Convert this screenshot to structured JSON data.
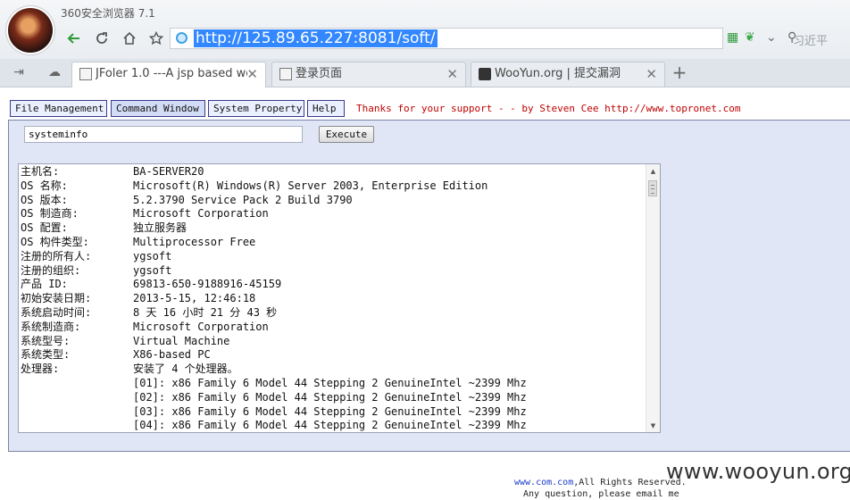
{
  "browser": {
    "title": "360安全浏览器 7.1",
    "url": "http://125.89.65.227:8081/soft/",
    "search_hint": "习近平",
    "icons": {
      "back": "back-arrow-icon",
      "reload": "reload-icon",
      "home": "home-icon",
      "favorite": "star-icon",
      "new_tab": "plus-icon"
    }
  },
  "tabs": [
    {
      "label": "JFoler 1.0 ---A jsp based web",
      "active": true
    },
    {
      "label": "登录页面",
      "active": false
    },
    {
      "label": "WooYun.org | 提交漏洞",
      "active": false
    }
  ],
  "menu": {
    "items": [
      "File Management",
      "Command Window",
      "System Property",
      "Help"
    ],
    "active": "Command Window",
    "thanks": "Thanks for your support - - by Steven Cee http://www.topronet.com"
  },
  "command": {
    "value": "systeminfo",
    "execute_label": "Execute"
  },
  "output": [
    {
      "key": "主机名:",
      "value": "BA-SERVER20"
    },
    {
      "key": "OS 名称:",
      "value": "Microsoft(R) Windows(R) Server 2003, Enterprise Edition"
    },
    {
      "key": "OS 版本:",
      "value": "5.2.3790 Service Pack 2 Build 3790"
    },
    {
      "key": "OS 制造商:",
      "value": "Microsoft Corporation"
    },
    {
      "key": "OS 配置:",
      "value": "独立服务器"
    },
    {
      "key": "OS 构件类型:",
      "value": "Multiprocessor Free"
    },
    {
      "key": "注册的所有人:",
      "value": "ygsoft"
    },
    {
      "key": "注册的组织:",
      "value": "ygsoft"
    },
    {
      "key": "产品 ID:",
      "value": "69813-650-9188916-45159"
    },
    {
      "key": "初始安装日期:",
      "value": "2013-5-15, 12:46:18"
    },
    {
      "key": "系统启动时间:",
      "value": "8 天 16 小时 21 分 43 秒"
    },
    {
      "key": "系统制造商:",
      "value": "Microsoft Corporation"
    },
    {
      "key": "系统型号:",
      "value": "Virtual Machine"
    },
    {
      "key": "系统类型:",
      "value": "X86-based PC"
    },
    {
      "key": "处理器:",
      "value": "安装了 4 个处理器。"
    },
    {
      "key": "",
      "value": "[01]: x86 Family 6 Model 44 Stepping 2 GenuineIntel ~2399 Mhz"
    },
    {
      "key": "",
      "value": "[02]: x86 Family 6 Model 44 Stepping 2 GenuineIntel ~2399 Mhz"
    },
    {
      "key": "",
      "value": "[03]: x86 Family 6 Model 44 Stepping 2 GenuineIntel ~2399 Mhz"
    },
    {
      "key": "",
      "value": "[04]: x86 Family 6 Model 44 Stepping 2 GenuineIntel ~2399 Mhz"
    }
  ],
  "footer": {
    "link": "www.com.com",
    "rights": ",All Rights Reserved.",
    "line2": "Any question, please email me"
  },
  "watermark": "www.wooyun.org"
}
